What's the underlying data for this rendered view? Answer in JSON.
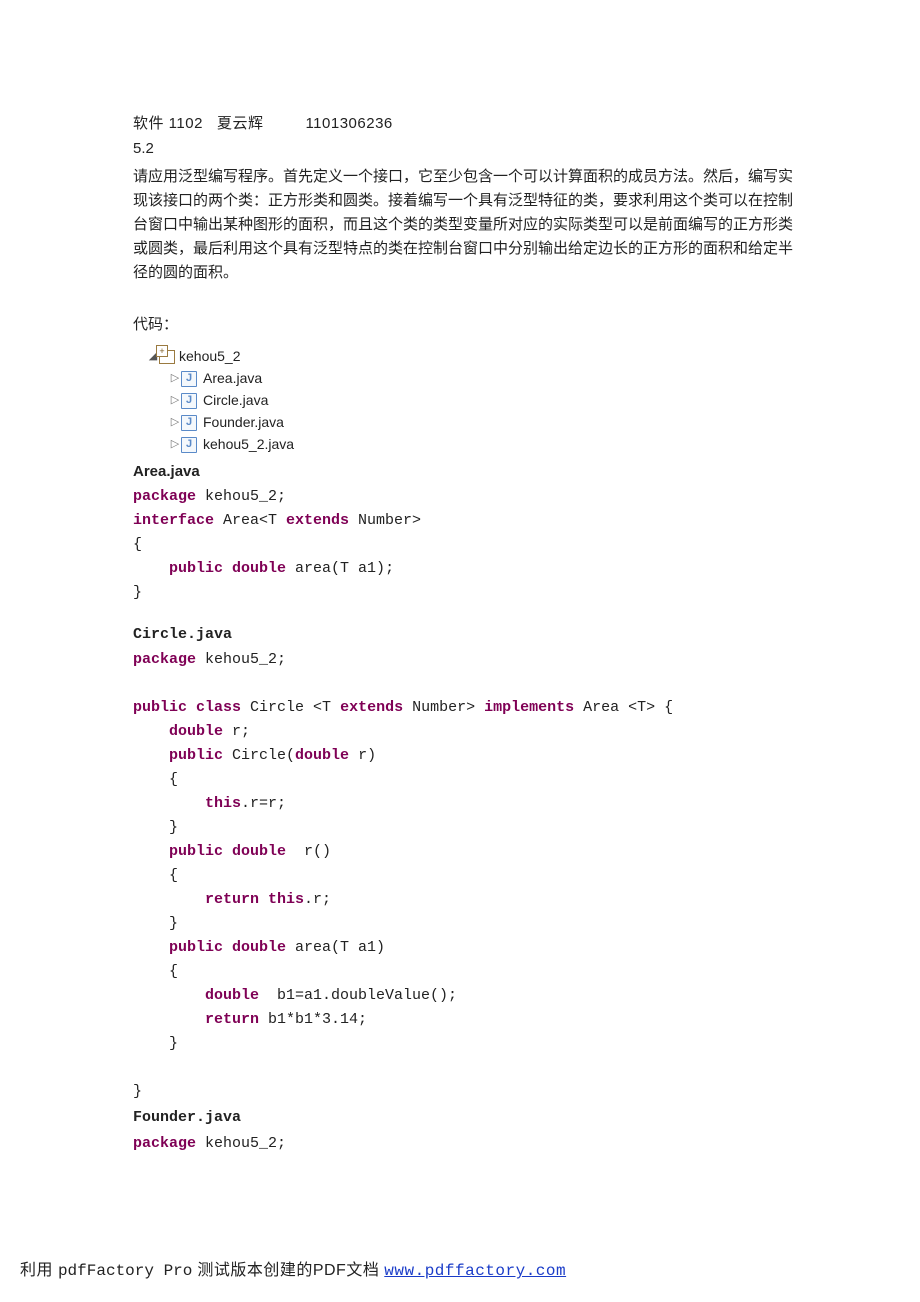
{
  "header": {
    "class_id": "软件 1102",
    "name": "夏云辉",
    "student_id": "1101306236"
  },
  "section": "5.2",
  "problem": "请应用泛型编写程序。首先定义一个接口，它至少包含一个可以计算面积的成员方法。然后，编写实现该接口的两个类：正方形类和圆类。接着编写一个具有泛型特征的类，要求利用这个类可以在控制台窗口中输出某种图形的面积，而且这个类的类型变量所对应的实际类型可以是前面编写的正方形类或圆类，最后利用这个具有泛型特点的类在控制台窗口中分别输出给定边长的正方形的面积和给定半径的圆的面积。",
  "code_label": "代码：",
  "tree": {
    "package": "kehou5_2",
    "files": [
      "Area.java",
      "Circle.java",
      "Founder.java",
      "kehou5_2.java"
    ]
  },
  "files": {
    "area": {
      "title": "Area.java",
      "line1_kw": "package",
      "line1_rest": " kehou5_2;",
      "line2_kw1": "interface",
      "line2_mid": " Area<T ",
      "line2_kw2": "extends",
      "line2_end": " Number>",
      "line3": "{",
      "line4_pad": "    ",
      "line4_kw": "public double",
      "line4_rest": " area(T a1);",
      "line5": "}"
    },
    "circle": {
      "title": "Circle.java",
      "l1_kw": "package",
      "l1_rest": " kehou5_2;",
      "l2_kw1": "public class",
      "l2_mid1": " Circle <T ",
      "l2_kw2": "extends",
      "l2_mid2": " Number> ",
      "l2_kw3": "implements",
      "l2_end": " Area <T> {",
      "l3_pad": "    ",
      "l3_kw": "double",
      "l3_rest": " r;",
      "l4_pad": "    ",
      "l4_kw": "public",
      "l4_mid": " Circle(",
      "l4_kw2": "double",
      "l4_end": " r)",
      "l5_pad": "    ",
      "l5": "{",
      "l6_pad": "        ",
      "l6_kw": "this",
      "l6_rest": ".r=r;",
      "l7_pad": "    ",
      "l7": "}",
      "l8_pad": "    ",
      "l8_kw": "public double",
      "l8_rest": "  r()",
      "l9_pad": "    ",
      "l9": "{",
      "l10_pad": "        ",
      "l10_kw": "return this",
      "l10_rest": ".r;",
      "l11_pad": "    ",
      "l11": "}",
      "l12_pad": "    ",
      "l12_kw": "public double",
      "l12_rest": " area(T a1)",
      "l13_pad": "    ",
      "l13": "{",
      "l14_pad": "        ",
      "l14_kw": "double",
      "l14_rest": "  b1=a1.doubleValue();",
      "l15_pad": "        ",
      "l15_kw": "return",
      "l15_rest": " b1*b1*3.14;",
      "l16_pad": "    ",
      "l16": "}",
      "l17": "",
      "l18": "}"
    },
    "founder": {
      "title": "Founder.java",
      "l1_kw": "package",
      "l1_rest": " kehou5_2;"
    }
  },
  "footer": {
    "prefix": "利用 ",
    "product": "pdfFactory Pro",
    "mid": " 测试版本创建的PDF文档 ",
    "link": "www.pdffactory.com"
  }
}
